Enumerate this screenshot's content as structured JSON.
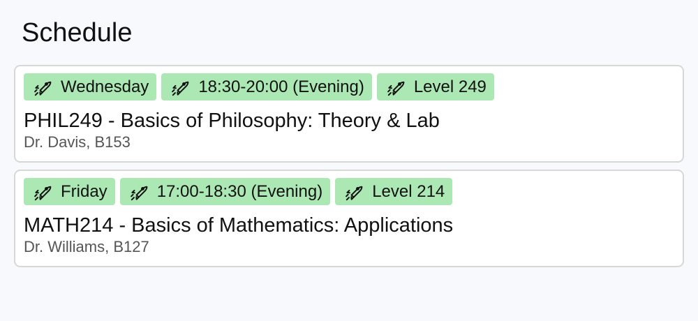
{
  "page": {
    "title": "Schedule"
  },
  "courses": [
    {
      "tags": [
        {
          "icon": "rocket-icon",
          "label": "Wednesday"
        },
        {
          "icon": "rocket-icon",
          "label": "18:30-20:00 (Evening)"
        },
        {
          "icon": "rocket-icon",
          "label": "Level 249"
        }
      ],
      "title": "PHIL249 - Basics of Philosophy: Theory & Lab",
      "meta": "Dr. Davis, B153"
    },
    {
      "tags": [
        {
          "icon": "rocket-icon",
          "label": "Friday"
        },
        {
          "icon": "rocket-icon",
          "label": "17:00-18:30 (Evening)"
        },
        {
          "icon": "rocket-icon",
          "label": "Level 214"
        }
      ],
      "title": "MATH214 - Basics of Mathematics: Applications",
      "meta": "Dr. Williams, B127"
    }
  ],
  "colors": {
    "background": "#f8f9fd",
    "card_border": "#d7d7d7",
    "tag_background": "#abe8b3",
    "text": "#111111",
    "muted_text": "#555555"
  }
}
